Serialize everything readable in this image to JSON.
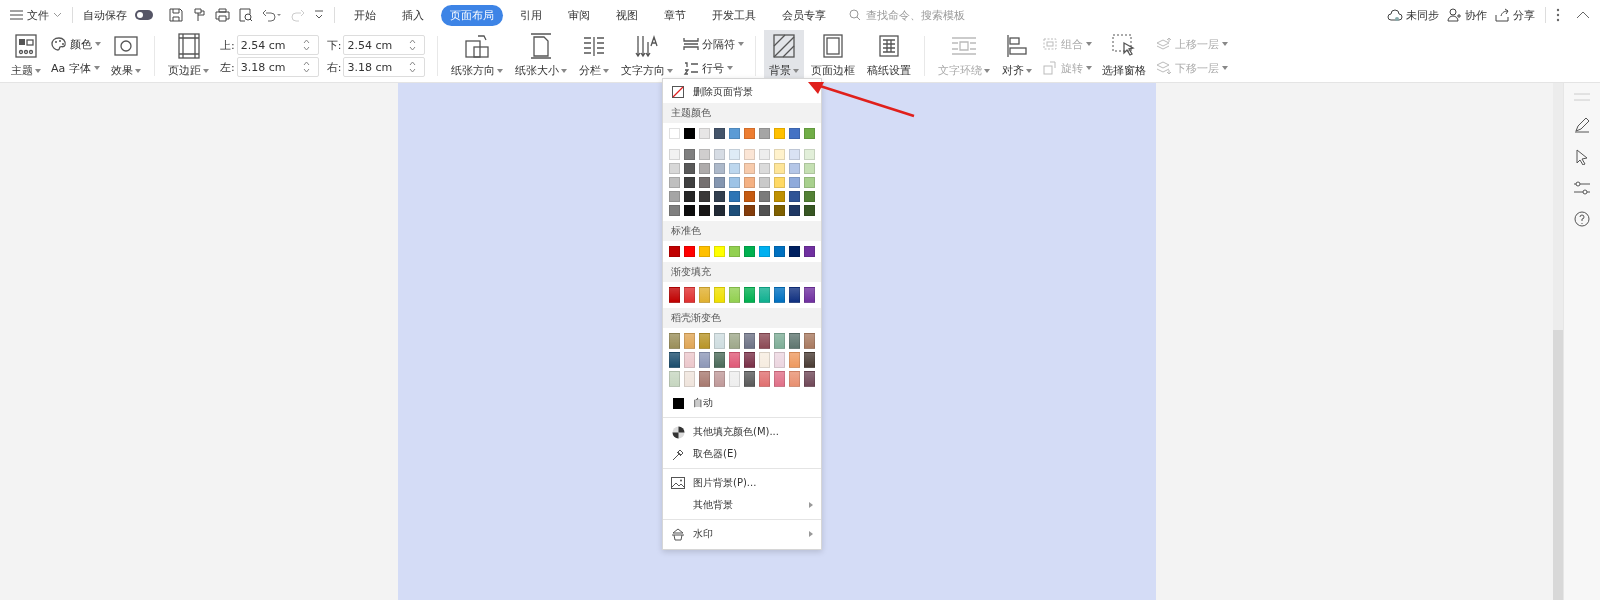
{
  "topbar": {
    "file_menu": "文件",
    "autosave": {
      "label": "自动保存",
      "on": false
    },
    "tabs": [
      {
        "label": "开始",
        "selected": false
      },
      {
        "label": "插入",
        "selected": false
      },
      {
        "label": "页面布局",
        "selected": true
      },
      {
        "label": "引用",
        "selected": false
      },
      {
        "label": "审阅",
        "selected": false
      },
      {
        "label": "视图",
        "selected": false
      },
      {
        "label": "章节",
        "selected": false
      },
      {
        "label": "开发工具",
        "selected": false
      },
      {
        "label": "会员专享",
        "selected": false
      }
    ],
    "search": {
      "placeholder": "查找命令、搜索模板"
    },
    "actions": [
      "未同步",
      "协作",
      "分享"
    ]
  },
  "ribbon": [
    {
      "kind": "large",
      "label": "主题",
      "dropdown": true,
      "disabled": false,
      "active": false
    },
    {
      "kind": "pair",
      "items": [
        {
          "label": "颜色",
          "dropdown": true,
          "disabled": false
        },
        {
          "label": "Aa 字体",
          "dropdown": true,
          "disabled": false
        }
      ]
    },
    {
      "kind": "large",
      "label": "效果",
      "dropdown": true,
      "disabled": false,
      "active": false
    },
    {
      "kind": "large",
      "label": "页边距",
      "dropdown": true,
      "disabled": false,
      "active": false
    },
    {
      "kind": "margins",
      "fields": [
        {
          "label": "上:",
          "value": "2.54 cm"
        },
        {
          "label": "下:",
          "value": "2.54 cm"
        },
        {
          "label": "左:",
          "value": "3.18 cm"
        },
        {
          "label": "右:",
          "value": "3.18 cm"
        }
      ]
    },
    {
      "kind": "large",
      "label": "纸张方向",
      "dropdown": true,
      "disabled": false,
      "active": false
    },
    {
      "kind": "large",
      "label": "纸张大小",
      "dropdown": true,
      "disabled": false,
      "active": false
    },
    {
      "kind": "large",
      "label": "分栏",
      "dropdown": true,
      "disabled": false,
      "active": false
    },
    {
      "kind": "large",
      "label": "文字方向",
      "dropdown": true,
      "disabled": false,
      "active": false
    },
    {
      "kind": "pair",
      "items": [
        {
          "label": "分隔符",
          "dropdown": true,
          "disabled": false
        },
        {
          "label": "行号",
          "dropdown": true,
          "disabled": false
        }
      ]
    },
    {
      "kind": "large",
      "label": "背景",
      "dropdown": true,
      "disabled": false,
      "active": true
    },
    {
      "kind": "large",
      "label": "页面边框",
      "dropdown": false,
      "disabled": false,
      "active": false
    },
    {
      "kind": "large",
      "label": "稿纸设置",
      "dropdown": false,
      "disabled": false,
      "active": false
    },
    {
      "kind": "large",
      "label": "文字环绕",
      "dropdown": true,
      "disabled": true,
      "active": false
    },
    {
      "kind": "large",
      "label": "对齐",
      "dropdown": true,
      "disabled": false,
      "active": false
    },
    {
      "kind": "pair",
      "items": [
        {
          "label": "组合",
          "dropdown": true,
          "disabled": true
        },
        {
          "label": "旋转",
          "dropdown": true,
          "disabled": true
        }
      ]
    },
    {
      "kind": "large",
      "label": "选择窗格",
      "dropdown": false,
      "disabled": false,
      "active": false
    },
    {
      "kind": "pair",
      "items": [
        {
          "label": "上移一层",
          "dropdown": true,
          "disabled": true
        },
        {
          "label": "下移一层",
          "dropdown": true,
          "disabled": true
        }
      ]
    }
  ],
  "background_menu": [
    {
      "kind": "action",
      "label": "删除页面背景",
      "submenu": false
    },
    {
      "kind": "heading",
      "label": "主题颜色"
    },
    {
      "kind": "swatches",
      "rows": [
        [
          {
            "color": "#ffffff"
          },
          {
            "color": "#000000"
          },
          {
            "color": "#e7e6e6"
          },
          {
            "color": "#44546a"
          },
          {
            "color": "#5b9bd5"
          },
          {
            "color": "#ed7d31"
          },
          {
            "color": "#a5a5a5"
          },
          {
            "color": "#ffc000"
          },
          {
            "color": "#4472c4"
          },
          {
            "color": "#70ad47"
          }
        ]
      ]
    },
    {
      "kind": "swatches",
      "rows": [
        [
          {
            "color": "#f2f2f2"
          },
          {
            "color": "#7f7f7f"
          },
          {
            "color": "#d0cece"
          },
          {
            "color": "#d6dce4"
          },
          {
            "color": "#deebf6"
          },
          {
            "color": "#fbe5d5"
          },
          {
            "color": "#ededed"
          },
          {
            "color": "#fff2cc"
          },
          {
            "color": "#d9e2f3"
          },
          {
            "color": "#e2efd9"
          }
        ],
        [
          {
            "color": "#d8d8d8"
          },
          {
            "color": "#595959"
          },
          {
            "color": "#aeabab"
          },
          {
            "color": "#adb9ca"
          },
          {
            "color": "#bdd7ee"
          },
          {
            "color": "#f7cbac"
          },
          {
            "color": "#dbdbdb"
          },
          {
            "color": "#fee599"
          },
          {
            "color": "#b4c6e7"
          },
          {
            "color": "#c5e0b3"
          }
        ],
        [
          {
            "color": "#bfbfbf"
          },
          {
            "color": "#3f3f3f"
          },
          {
            "color": "#757070"
          },
          {
            "color": "#8496b0"
          },
          {
            "color": "#9dc3e6"
          },
          {
            "color": "#f4b183"
          },
          {
            "color": "#c9c9c9"
          },
          {
            "color": "#ffd965"
          },
          {
            "color": "#8eaadb"
          },
          {
            "color": "#a8d08d"
          }
        ],
        [
          {
            "color": "#a5a5a5"
          },
          {
            "color": "#262626"
          },
          {
            "color": "#3a3838"
          },
          {
            "color": "#323f4f"
          },
          {
            "color": "#2e75b5"
          },
          {
            "color": "#c55a11"
          },
          {
            "color": "#7b7b7b"
          },
          {
            "color": "#bf9000"
          },
          {
            "color": "#2f5496"
          },
          {
            "color": "#538135"
          }
        ],
        [
          {
            "color": "#7f7f7f"
          },
          {
            "color": "#0c0c0c"
          },
          {
            "color": "#171616"
          },
          {
            "color": "#222a35"
          },
          {
            "color": "#1e4e79"
          },
          {
            "color": "#833c0b"
          },
          {
            "color": "#525252"
          },
          {
            "color": "#7f6000"
          },
          {
            "color": "#1f3864"
          },
          {
            "color": "#375623"
          }
        ]
      ]
    },
    {
      "kind": "heading",
      "label": "标准色"
    },
    {
      "kind": "swatches",
      "rows": [
        [
          {
            "color": "#c00000"
          },
          {
            "color": "#ff0000"
          },
          {
            "color": "#ffc000"
          },
          {
            "color": "#ffff00"
          },
          {
            "color": "#92d050"
          },
          {
            "color": "#00b050"
          },
          {
            "color": "#00b0f0"
          },
          {
            "color": "#0070c0"
          },
          {
            "color": "#002060"
          },
          {
            "color": "#7030a0"
          }
        ]
      ]
    },
    {
      "kind": "heading",
      "label": "渐变填充"
    },
    {
      "kind": "gradients",
      "rows": [
        [
          {
            "color": "#c00000"
          },
          {
            "color": "#e03030"
          },
          {
            "color": "#e0b030"
          },
          {
            "color": "#f0e000"
          },
          {
            "color": "#92d050"
          },
          {
            "color": "#00b050"
          },
          {
            "color": "#10b090"
          },
          {
            "color": "#0070c0"
          },
          {
            "color": "#103080"
          },
          {
            "color": "#7030a0"
          }
        ]
      ]
    },
    {
      "kind": "heading",
      "label": "稻壳渐变色"
    },
    {
      "kind": "gradients",
      "rows": [
        [
          {
            "color": "#9a8f5a"
          },
          {
            "color": "#e0a656"
          },
          {
            "color": "#b89528"
          },
          {
            "color": "#cfdde0"
          },
          {
            "color": "#9ea88a"
          },
          {
            "color": "#6e7386"
          },
          {
            "color": "#8c4a55"
          },
          {
            "color": "#7fae98"
          },
          {
            "color": "#5f7670"
          },
          {
            "color": "#a97a60"
          }
        ],
        [
          {
            "color": "#1c4e6e"
          },
          {
            "color": "#ecc8cc"
          },
          {
            "color": "#8e98b8"
          },
          {
            "color": "#4c6b5a"
          },
          {
            "color": "#e05a78"
          },
          {
            "color": "#7a3048"
          },
          {
            "color": "#f6ece0"
          },
          {
            "color": "#ecd6e0"
          },
          {
            "color": "#ee9a60"
          },
          {
            "color": "#4a3c34"
          }
        ],
        [
          {
            "color": "#c6d6c0"
          },
          {
            "color": "#efe4dc"
          },
          {
            "color": "#a87a70"
          },
          {
            "color": "#c09a9a"
          },
          {
            "color": "#eeeeee"
          },
          {
            "color": "#5a5a5a"
          },
          {
            "color": "#e07070"
          },
          {
            "color": "#e07088"
          },
          {
            "color": "#e89070"
          },
          {
            "color": "#704858"
          }
        ]
      ]
    },
    {
      "kind": "action",
      "label": "自动",
      "submenu": false
    },
    {
      "kind": "separator"
    },
    {
      "kind": "action",
      "label": "其他填充颜色(M)...",
      "submenu": false
    },
    {
      "kind": "action",
      "label": "取色器(E)",
      "submenu": false
    },
    {
      "kind": "separator"
    },
    {
      "kind": "action",
      "label": "图片背景(P)...",
      "submenu": false
    },
    {
      "kind": "action",
      "label": "其他背景",
      "submenu": true
    },
    {
      "kind": "separator"
    },
    {
      "kind": "action",
      "label": "水印",
      "submenu": true
    }
  ]
}
